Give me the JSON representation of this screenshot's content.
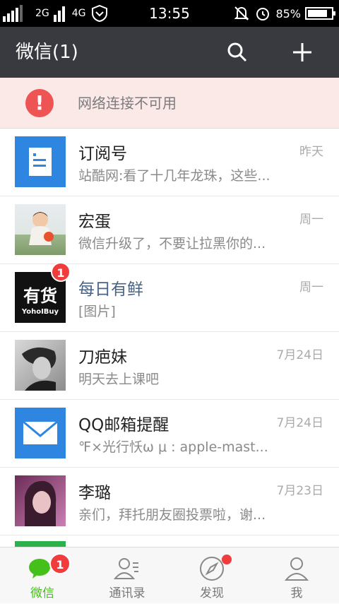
{
  "status_bar": {
    "carrier_left": "2G",
    "network": "4G",
    "time": "13:55",
    "battery_percent": "85%",
    "battery_level": 0.85
  },
  "header": {
    "title": "微信(1)"
  },
  "network_warning": {
    "text": "网络连接不可用"
  },
  "chats": [
    {
      "name": "订阅号",
      "preview": "站酷网:看了十几年龙珠，这些...",
      "time": "昨天",
      "avatar": "subscription-icon"
    },
    {
      "name": "宏蛋",
      "preview": "微信升级了，不要让拉黑你的...",
      "time": "周一",
      "avatar": "baby-photo"
    },
    {
      "name": "每日有鲜",
      "preview": "[图片]",
      "time": "周一",
      "avatar": "yohobuy-logo",
      "badge": "1",
      "logo_text": "有货",
      "logo_sub": "YohoIBuy"
    },
    {
      "name": "刀疤妹",
      "preview": "明天去上课吧",
      "time": "7月24日",
      "avatar": "girl-photo"
    },
    {
      "name": "QQ邮箱提醒",
      "preview": "℉×光行㤇ω μ : apple-mast...",
      "time": "7月24日",
      "avatar": "mail-icon"
    },
    {
      "name": "李璐",
      "preview": "亲们，拜托朋友圈投票啦，谢...",
      "time": "7月23日",
      "avatar": "girl-photo-2"
    }
  ],
  "bottom_nav": [
    {
      "label": "微信",
      "icon": "chat-bubble-icon",
      "badge": "1",
      "active": true
    },
    {
      "label": "通讯录",
      "icon": "contacts-icon"
    },
    {
      "label": "发现",
      "icon": "compass-icon",
      "dot": true
    },
    {
      "label": "我",
      "icon": "profile-icon"
    }
  ],
  "colors": {
    "header_bg": "#393a3f",
    "accent_green": "#45c01a",
    "badge_red": "#f03c3c",
    "warning_bg": "#fbe9e8"
  }
}
